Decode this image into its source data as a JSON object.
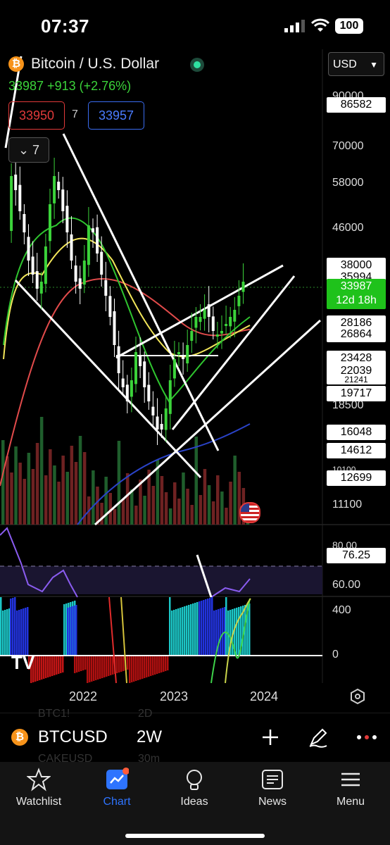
{
  "status": {
    "time": "07:37",
    "battery": "100"
  },
  "header": {
    "title": "Bitcoin / U.S. Dollar",
    "change": "33987 +913 (+2.76%)",
    "currency": "USD",
    "bid": "33950",
    "spread": "7",
    "ask": "33957",
    "indicators_count": "7"
  },
  "price_axis": {
    "ticks": [
      "90000",
      "70000",
      "58000",
      "46000",
      "38000",
      "35994",
      "28186",
      "26864",
      "23428",
      "22039",
      "21241",
      "19717",
      "18500",
      "16048",
      "14612",
      "10100",
      "12699",
      "11100"
    ],
    "highlight": {
      "price": "33987",
      "countdown": "12d 18h"
    },
    "top_label": "86582"
  },
  "rsi": {
    "levels": [
      "80.00",
      "60.00"
    ],
    "current": "76.25"
  },
  "osc": {
    "levels": [
      "400",
      "0"
    ]
  },
  "time_axis": [
    "2022",
    "2023",
    "2024"
  ],
  "symbol_bar": {
    "symbol": "BTCUSD",
    "interval": "2W",
    "ghost_symbol_above": "BTC1!",
    "ghost_interval_above": "2D",
    "ghost_symbol_below": "CAKEUSD",
    "ghost_interval_below": "30m"
  },
  "tabs": [
    {
      "label": "Watchlist",
      "icon": "star-icon"
    },
    {
      "label": "Chart",
      "icon": "chart-icon"
    },
    {
      "label": "Ideas",
      "icon": "lightbulb-icon"
    },
    {
      "label": "News",
      "icon": "newspaper-icon"
    },
    {
      "label": "Menu",
      "icon": "menu-icon"
    }
  ],
  "colors": {
    "up": "#3bd33a",
    "down": "#ffffff",
    "accent": "#2e74ff",
    "bid": "#e23a3a",
    "ask": "#3a6cf0",
    "highlight": "#1fc21b"
  }
}
